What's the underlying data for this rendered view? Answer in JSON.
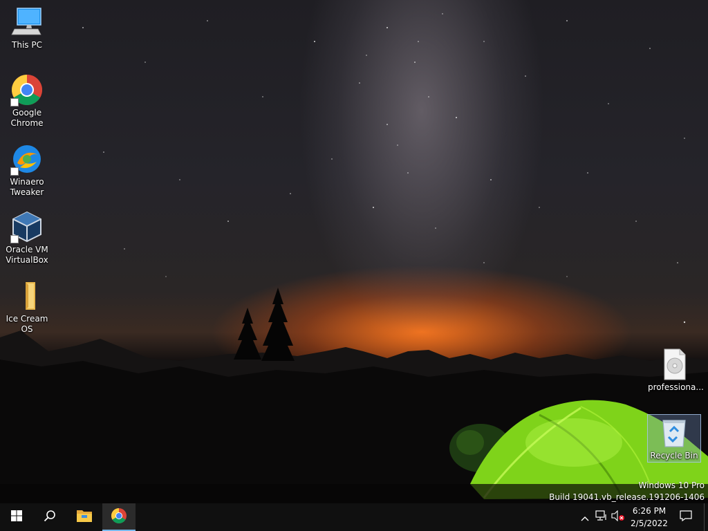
{
  "desktop": {
    "icons": [
      {
        "label": "This PC",
        "icon": "this-pc-icon"
      },
      {
        "label": "Google Chrome",
        "icon": "chrome-icon"
      },
      {
        "label": "Winaero Tweaker",
        "icon": "winaero-tweaker-icon"
      },
      {
        "label": "Oracle VM VirtualBox",
        "icon": "virtualbox-icon"
      },
      {
        "label": "Ice Cream OS",
        "icon": "folder-icon"
      },
      {
        "label": "professiona...",
        "icon": "disc-image-file-icon"
      },
      {
        "label": "Recycle Bin",
        "icon": "recycle-bin-icon"
      }
    ],
    "watermark": {
      "edition": "Windows 10 Pro",
      "build": "Build 19041.vb_release.191206-1406"
    }
  },
  "taskbar": {
    "start_icon": "windows-start-icon",
    "search_icon": "search-icon",
    "pinned": [
      {
        "name": "File Explorer",
        "icon": "file-explorer-icon",
        "active": false
      },
      {
        "name": "Google Chrome",
        "icon": "chrome-icon",
        "active": true
      }
    ],
    "tray": {
      "icons": [
        "chevron-up-icon",
        "network-icon",
        "volume-muted-icon",
        "action-center-icon"
      ],
      "time": "6:26 PM",
      "date": "2/5/2022"
    }
  },
  "colors": {
    "taskbar_bg": "#101010",
    "active_indicator": "#76b9ed",
    "tent_green": "#8fe01a",
    "horizon_orange": "#ff7a1e"
  }
}
